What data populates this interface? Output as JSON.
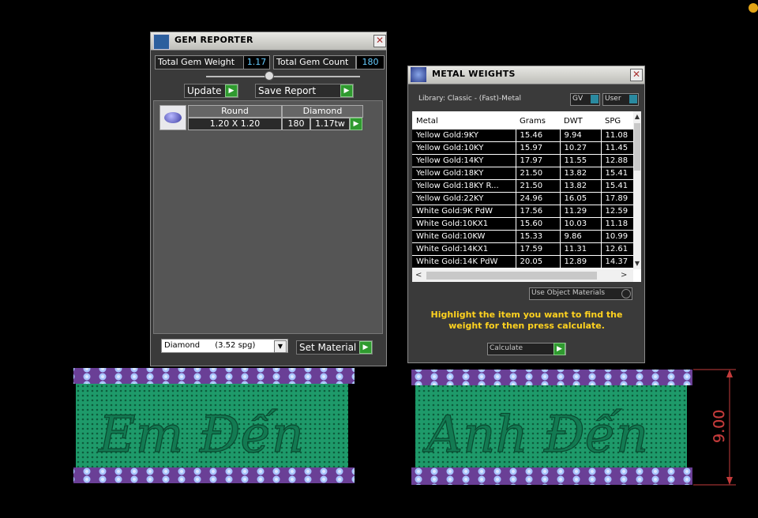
{
  "gem_reporter": {
    "title": "GEM REPORTER",
    "close": "✕",
    "total_weight_label": "Total Gem Weight",
    "total_weight_value": "1.17",
    "total_count_label": "Total Gem Count",
    "total_count_value": "180",
    "update_label": "Update",
    "save_report_label": "Save Report",
    "row": {
      "shape": "Round",
      "material": "Diamond",
      "size": "1.20 X 1.20",
      "count": "180",
      "weight": "1.17tw"
    },
    "material_select": "Diamond      (3.52 spg)",
    "set_material_label": "Set Material"
  },
  "metal_weights": {
    "title": "METAL WEIGHTS",
    "close": "✕",
    "library_label": "Library: Classic - (Fast)-Metal",
    "gv_label": "GV",
    "user_label": "User",
    "columns": [
      "Metal",
      "Grams",
      "DWT",
      "SPG"
    ],
    "rows": [
      [
        "Yellow Gold:9KY",
        "15.46",
        "9.94",
        "11.08"
      ],
      [
        "Yellow Gold:10KY",
        "15.97",
        "10.27",
        "11.45"
      ],
      [
        "Yellow Gold:14KY",
        "17.97",
        "11.55",
        "12.88"
      ],
      [
        "Yellow Gold:18KY",
        "21.50",
        "13.82",
        "15.41"
      ],
      [
        "Yellow Gold:18KY R...",
        "21.50",
        "13.82",
        "15.41"
      ],
      [
        "Yellow Gold:22KY",
        "24.96",
        "16.05",
        "17.89"
      ],
      [
        "White Gold:9K PdW",
        "17.56",
        "11.29",
        "12.59"
      ],
      [
        "White Gold:10KX1",
        "15.60",
        "10.03",
        "11.18"
      ],
      [
        "White Gold:10KW",
        "15.33",
        "9.86",
        "10.99"
      ],
      [
        "White Gold:14KX1",
        "17.59",
        "11.31",
        "12.61"
      ],
      [
        "White Gold:14K PdW",
        "20.05",
        "12.89",
        "14.37"
      ]
    ],
    "use_object_materials": "Use Object Materials",
    "instruction": "Highlight the item you want to find the weight for then press calculate.",
    "calculate_label": "Calculate"
  },
  "viewport": {
    "ring_left_text": "Em Đến",
    "ring_right_text": "Anh Đến",
    "dimension_label": "9.00"
  },
  "colors": {
    "accent_green": "#2f9a2f",
    "instruction_yellow": "#ffd21f",
    "dimension_red": "#c43b3b",
    "ring_green": "#1a8a60",
    "ring_purple": "#7a4aa8"
  }
}
